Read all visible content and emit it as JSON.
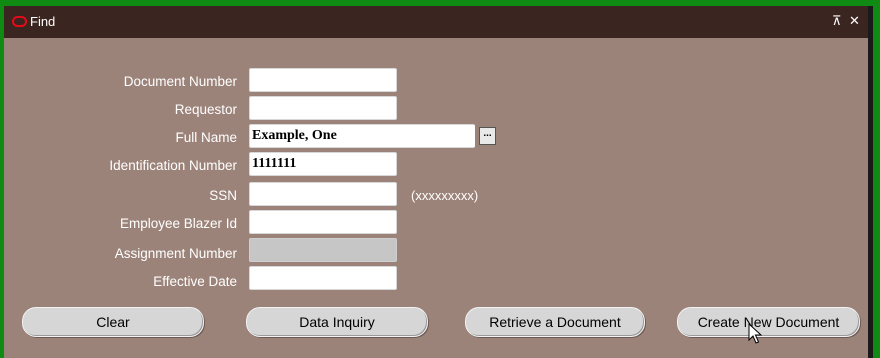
{
  "window": {
    "title": "Find",
    "maximize_glyph": "⊼",
    "close_glyph": "✕"
  },
  "form": {
    "fields": [
      {
        "label": "Document Number",
        "value": ""
      },
      {
        "label": "Requestor",
        "value": ""
      },
      {
        "label": "Full Name",
        "value": "Example, One"
      },
      {
        "label": "Identification Number",
        "value": "1111111"
      },
      {
        "label": "SSN",
        "value": "",
        "hint": "(xxxxxxxxx)"
      },
      {
        "label": "Employee Blazer Id",
        "value": ""
      },
      {
        "label": "Assignment Number",
        "value": ""
      },
      {
        "label": "Effective Date",
        "value": ""
      }
    ],
    "lov_glyph": "..."
  },
  "buttons": {
    "clear": "Clear",
    "data_inquiry": "Data Inquiry",
    "retrieve": "Retrieve a Document",
    "create": "Create New Document"
  },
  "colors": {
    "frame": "#0f8a13",
    "titlebar": "#3a2520",
    "window_bg": "#9c837a",
    "oracle_red": "#e30b17"
  },
  "icons": [
    "oracle-logo-icon",
    "maximize-icon",
    "close-icon",
    "ellipsis-icon",
    "mouse-pointer-icon"
  ]
}
